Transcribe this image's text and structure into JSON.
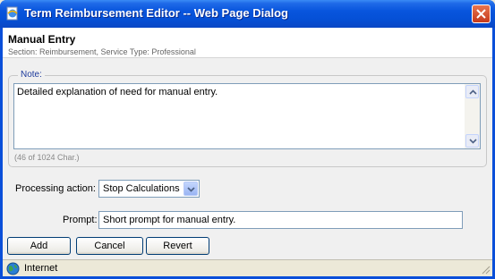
{
  "window": {
    "title": "Term Reimbursement Editor -- Web Page Dialog",
    "title_icon": "ie-page-icon",
    "close_icon": "close-icon"
  },
  "header": {
    "title": "Manual Entry",
    "subtitle": "Section: Reimbursement, Service Type: Professional"
  },
  "note": {
    "legend": "Note:",
    "text": "Detailed explanation of need for manual entry.",
    "char_count": "(46 of 1024 Char.)"
  },
  "processing": {
    "label": "Processing action:",
    "selected": "Stop Calculations"
  },
  "prompt": {
    "label": "Prompt:",
    "value": "Short prompt for manual entry."
  },
  "buttons": {
    "add": "Add",
    "cancel": "Cancel",
    "revert": "Revert"
  },
  "status": {
    "zone": "Internet",
    "zone_icon": "globe-icon"
  },
  "colors": {
    "titlebar": "#0855dd",
    "legend": "#1f3c9c",
    "field_border": "#7f9db9"
  }
}
